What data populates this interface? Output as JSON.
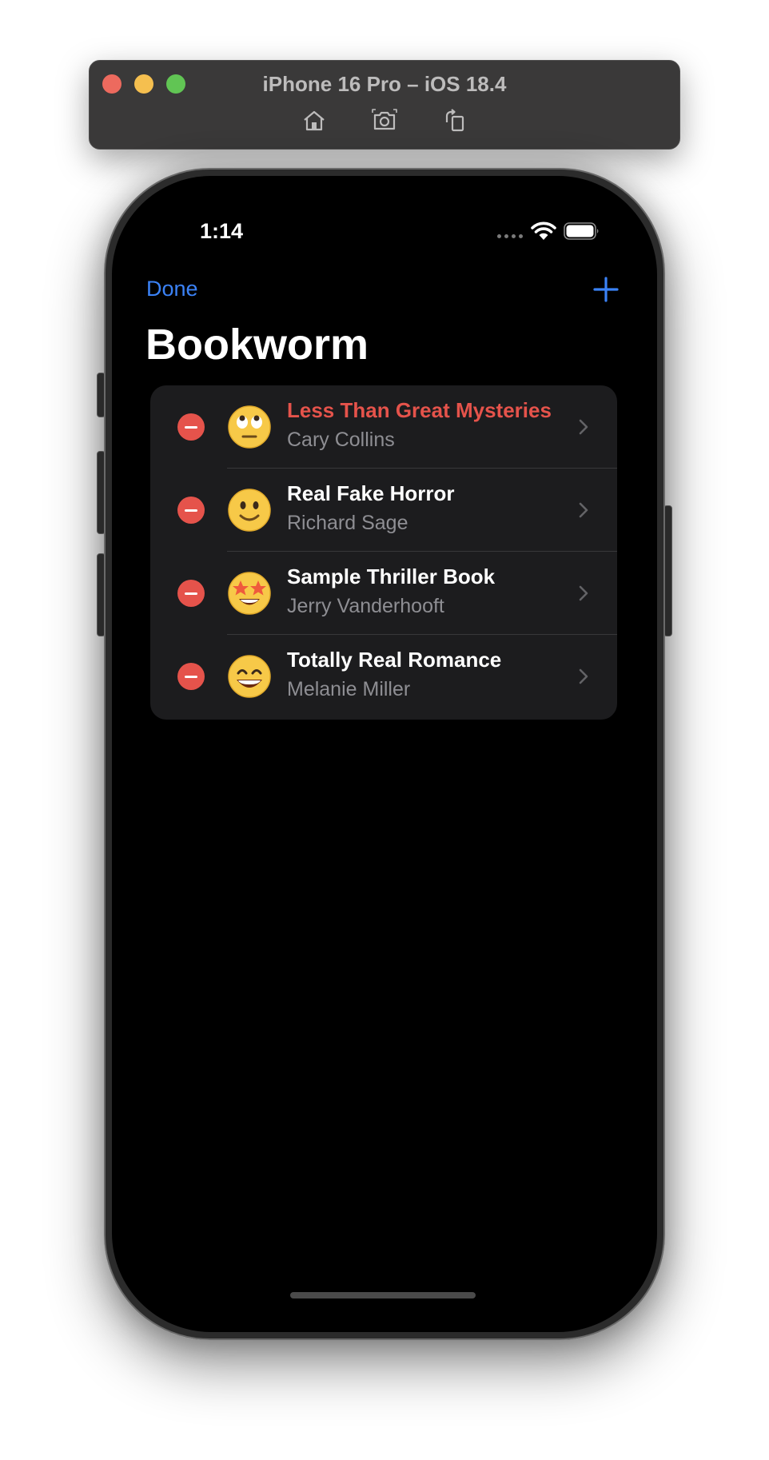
{
  "simulator": {
    "title": "iPhone 16 Pro – iOS 18.4",
    "tools": [
      "home-icon",
      "screenshot-icon",
      "rotate-icon"
    ]
  },
  "status_bar": {
    "time": "1:14"
  },
  "nav": {
    "done_label": "Done",
    "add_icon": "plus-icon"
  },
  "page": {
    "title": "Bookworm"
  },
  "books": [
    {
      "title": "Less Than Great Mysteries",
      "author": "Cary Collins",
      "emoji": "face-with-rolling-eyes",
      "highlight": "red"
    },
    {
      "title": "Real Fake Horror",
      "author": "Richard Sage",
      "emoji": "slightly-smiling-face"
    },
    {
      "title": "Sample Thriller Book",
      "author": "Jerry Vanderhooft",
      "emoji": "star-struck"
    },
    {
      "title": "Totally Real Romance",
      "author": "Melanie Miller",
      "emoji": "grinning-face-with-smiling-eyes"
    }
  ],
  "colors": {
    "accent": "#3b82f6",
    "destructive": "#e5534b",
    "list_background": "#1c1c1e",
    "secondary_text": "#8e8e93"
  }
}
